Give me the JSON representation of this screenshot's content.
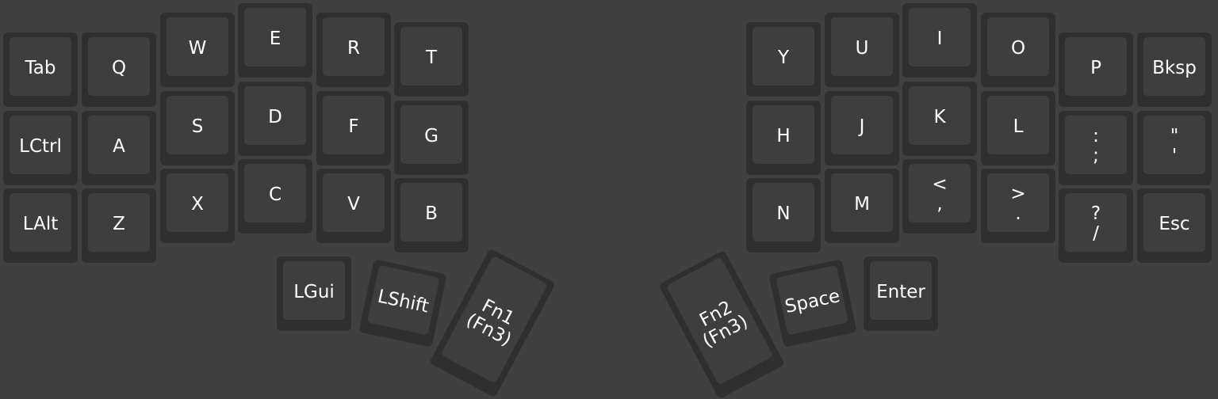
{
  "keyboard": {
    "left": {
      "col0": [
        "Tab",
        "LCtrl",
        "LAlt"
      ],
      "col1": [
        "Q",
        "A",
        "Z"
      ],
      "col2": [
        "W",
        "S",
        "X"
      ],
      "col3": [
        "E",
        "D",
        "C"
      ],
      "col4": [
        "R",
        "F",
        "V"
      ],
      "col5": [
        "T",
        "G",
        "B"
      ],
      "thumbs": [
        "LGui",
        "LShift",
        [
          "Fn1",
          "(Fn3)"
        ]
      ]
    },
    "right": {
      "col0": [
        "Y",
        "H",
        "N"
      ],
      "col1": [
        "U",
        "J",
        "M"
      ],
      "col2": [
        "I",
        "K",
        [
          "<",
          ","
        ]
      ],
      "col3": [
        "O",
        "L",
        [
          ">",
          "."
        ]
      ],
      "col4": [
        "P",
        [
          ":",
          ";"
        ],
        [
          "?",
          "/"
        ]
      ],
      "col5": [
        "Bksp",
        [
          "\"",
          "'"
        ],
        "Esc"
      ],
      "thumbs": [
        [
          "Fn2",
          "(Fn3)"
        ],
        "Space",
        "Enter"
      ]
    }
  }
}
